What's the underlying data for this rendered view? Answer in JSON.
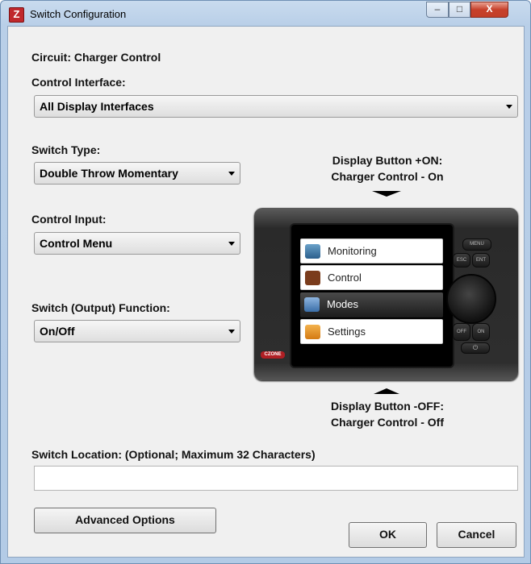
{
  "window": {
    "title": "Switch Configuration",
    "app_icon": "Z",
    "minimize": "–",
    "maximize": "□",
    "close": "X"
  },
  "circuit_label": "Circuit: Charger Control",
  "control_interface": {
    "label": "Control Interface:",
    "value": "All Display Interfaces"
  },
  "switch_type": {
    "label": "Switch Type:",
    "value": "Double Throw Momentary"
  },
  "control_input": {
    "label": "Control Input:",
    "value": "Control Menu"
  },
  "switch_function": {
    "label": "Switch (Output) Function:",
    "value": "On/Off"
  },
  "display_on": {
    "line1": "Display Button +ON:",
    "line2": "Charger Control - On"
  },
  "display_off": {
    "line1": "Display Button -OFF:",
    "line2": "Charger Control - Off"
  },
  "device_menu": {
    "items": [
      {
        "label": "Monitoring",
        "icon": "monitoring-icon"
      },
      {
        "label": "Control",
        "icon": "control-icon"
      },
      {
        "label": "Modes",
        "icon": "modes-icon"
      },
      {
        "label": "Settings",
        "icon": "settings-icon"
      }
    ],
    "logo": "CZONE",
    "menu_button": "MENU",
    "esc_button": "ESC",
    "ent_button": "ENT",
    "off_button": "OFF",
    "on_button": "ON",
    "power_symbol": "⏻"
  },
  "switch_location": {
    "label": "Switch Location: (Optional; Maximum 32 Characters)",
    "value": ""
  },
  "buttons": {
    "advanced": "Advanced Options",
    "ok": "OK",
    "cancel": "Cancel"
  },
  "colors": {
    "accent_red": "#c0282c",
    "frame_blue": "#b9cfe8"
  }
}
